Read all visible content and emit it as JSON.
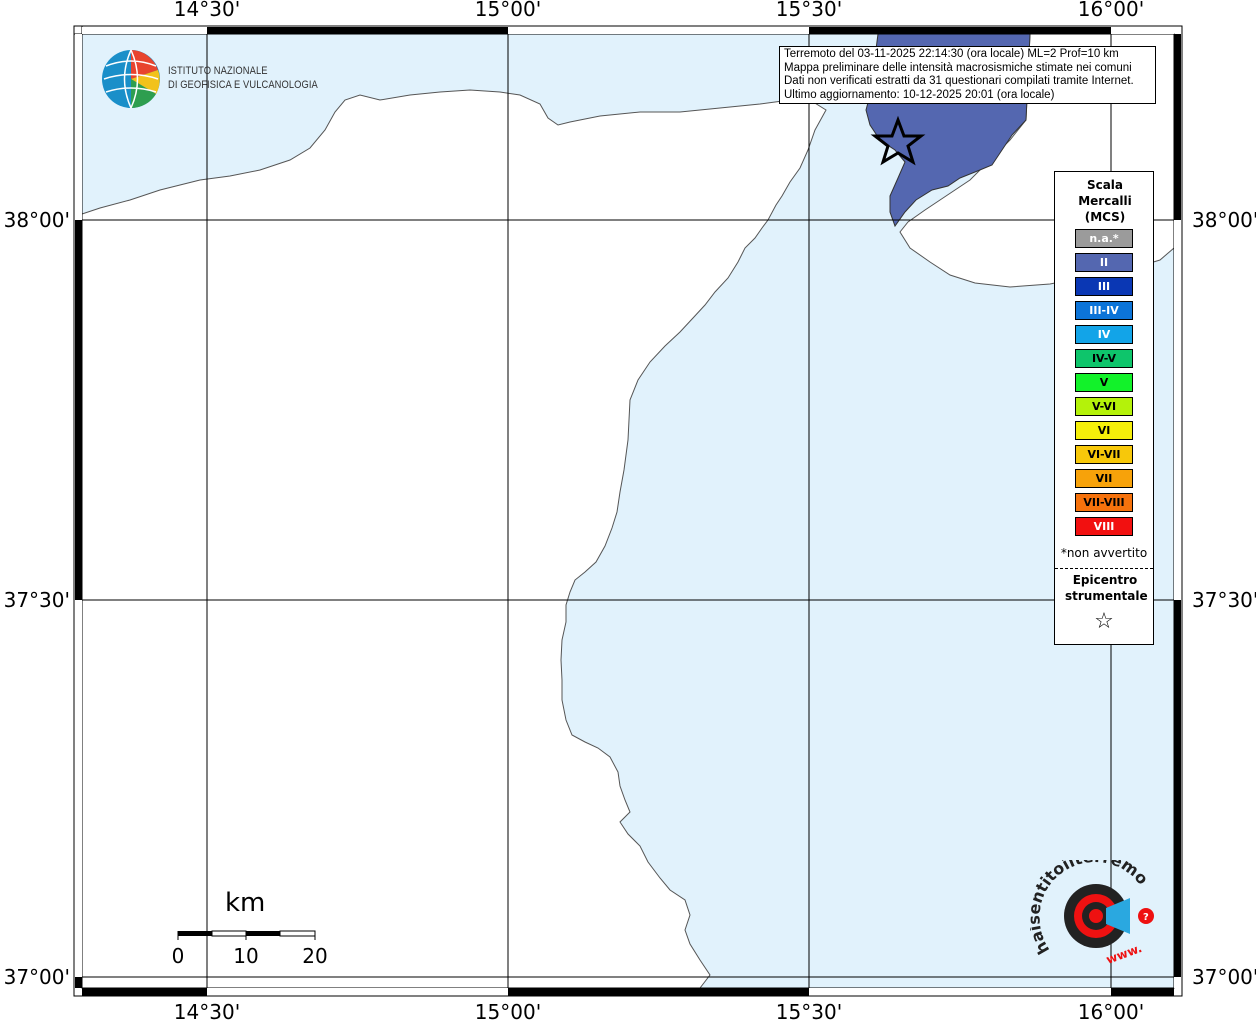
{
  "map": {
    "lon_labels": [
      "14°30'",
      "15°00'",
      "15°30'",
      "16°00'"
    ],
    "lat_labels": [
      "38°00'",
      "37°30'",
      "37°00'"
    ],
    "colors": {
      "sea": "#e1f2fc",
      "land": "#ffffff",
      "intensity_II_area": "#5467b0"
    }
  },
  "info_box": {
    "line1": "Terremoto del 03-11-2025 22:14:30 (ora locale) ML=2 Prof=10 km",
    "line2": "Mappa preliminare delle intensità macrosismiche stimate nei comuni",
    "line3": "Dati non verificati estratti da 31 questionari compilati tramite Internet.",
    "line4": "Ultimo aggiornamento: 10-12-2025 20:01 (ora locale)"
  },
  "legend": {
    "title": "Scala Mercalli (MCS)",
    "items": [
      {
        "label": "n.a.*",
        "color": "#9b9b9b"
      },
      {
        "label": "II",
        "color": "#5467b0"
      },
      {
        "label": "III",
        "color": "#0a37b4"
      },
      {
        "label": "III-IV",
        "color": "#0c74d8"
      },
      {
        "label": "IV",
        "color": "#12a4e8"
      },
      {
        "label": "IV-V",
        "color": "#0ec56b"
      },
      {
        "label": "V",
        "color": "#12f22a"
      },
      {
        "label": "V-VI",
        "color": "#b4f20a"
      },
      {
        "label": "VI",
        "color": "#f5ef0a"
      },
      {
        "label": "VI-VII",
        "color": "#f7c80a"
      },
      {
        "label": "VII",
        "color": "#f7a20a"
      },
      {
        "label": "VII-VIII",
        "color": "#f6720c"
      },
      {
        "label": "VIII",
        "color": "#f21010"
      }
    ],
    "note": "*non avvertito",
    "epicenter_label": "Epicentro strumentale",
    "epicenter_symbol": "☆"
  },
  "logo_ingv": {
    "line1": "ISTITUTO NAZIONALE",
    "line2": "DI GEOFISICA E VULCANOLOGIA"
  },
  "scale_bar": {
    "unit": "km",
    "labels": [
      "0",
      "10",
      "20"
    ]
  },
  "logo_hst": {
    "text_main": "haisentitoilterremoto.it",
    "text_prefix": "www."
  }
}
